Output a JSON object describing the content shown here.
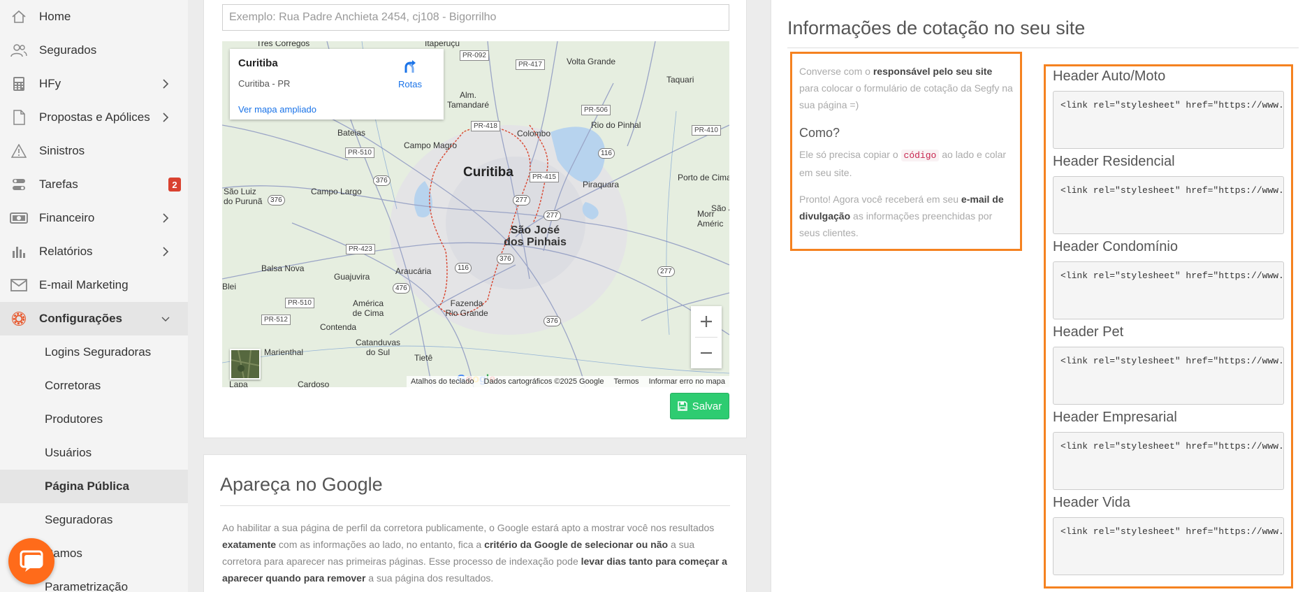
{
  "sidebar": {
    "items": [
      {
        "label": "Home",
        "icon": "home-icon"
      },
      {
        "label": "Segurados",
        "icon": "users-icon"
      },
      {
        "label": "HFy",
        "icon": "calculator-icon",
        "chevron": true
      },
      {
        "label": "Propostas e Apólices",
        "icon": "document-icon",
        "chevron": true
      },
      {
        "label": "Sinistros",
        "icon": "warning-icon"
      },
      {
        "label": "Tarefas",
        "icon": "tasks-icon",
        "badge": "2"
      },
      {
        "label": "Financeiro",
        "icon": "money-icon",
        "chevron": true
      },
      {
        "label": "Relatórios",
        "icon": "bar-chart-icon",
        "chevron": true
      },
      {
        "label": "E-mail Marketing",
        "icon": "envelope-icon"
      },
      {
        "label": "Configurações",
        "icon": "gear-icon",
        "expanded": true
      }
    ],
    "subitems": [
      "Logins Seguradoras",
      "Corretoras",
      "Produtores",
      "Usuários",
      "Página Pública",
      "Seguradoras",
      "Ramos",
      "Parametrização"
    ],
    "active_subitem": "Página Pública"
  },
  "address": {
    "placeholder": "Exemplo: Rua Padre Anchieta 2454, cj108 - Bigorrilho"
  },
  "map": {
    "place_name": "Curitiba",
    "place_region": "Curitiba - PR",
    "routes_label": "Rotas",
    "larger_map_link": "Ver mapa ampliado",
    "labels": {
      "curitiba": "Curitiba",
      "sao_jose": "São José dos Pinhais",
      "tres_corregos": "Três Córregos",
      "itaperucu": "Itaperuçu",
      "volta_grande": "Volta Grande",
      "taquari": "Taquari",
      "almirante": "Alm. Tamandaré",
      "rio_do_pinhal": "Rio do Pinhal",
      "colombo": "Colombo",
      "bateias": "Bateias",
      "campo_magro": "Campo Magro",
      "sao_luiz": "São Luiz do Purunã",
      "campo_largo": "Campo Largo",
      "piraquara": "Piraquara",
      "porto_de_cima": "Porto de Cima",
      "sao_joao": "São J",
      "morretes": "Morr Améric",
      "balsa_nova": "Balsa Nova",
      "guajuvira": "Guajuvira",
      "araucaria": "Araucária",
      "bleri": "Blei",
      "america_de_cima": "América de Cima",
      "fazenda": "Fazenda Rio Grande",
      "contenda": "Contenda",
      "catanduvas": "Catanduvas do Sul",
      "marienthal": "Marienthal",
      "tiete": "Tietê",
      "lapa": "Lapa",
      "cardoso": "Cardoso"
    },
    "roads": {
      "pr092": "PR-092",
      "pr417": "PR-417",
      "pr418": "PR-418",
      "pr506": "PR-506",
      "pr410": "PR-410",
      "pr510a": "PR-510",
      "pr415": "PR-415",
      "pr423": "PR-423",
      "pr510b": "PR-510",
      "pr512": "PR-512",
      "n376a": "376",
      "n376b": "376",
      "n376c": "376",
      "n376d": "376",
      "n277a": "277",
      "n277b": "277",
      "n277c": "277",
      "n116a": "116",
      "n116b": "116",
      "n476": "476"
    },
    "google": "Google",
    "footer": [
      "Atalhos do teclado",
      "Dados cartográficos ©2025 Google",
      "Termos",
      "Informar erro no mapa"
    ]
  },
  "save_label": "Salvar",
  "google_card": {
    "title": "Apareça no Google",
    "text_parts": [
      "Ao habilitar a sua página de perfil da corretora publicamente, o Google estará apto a mostrar você nos resultados ",
      "exatamente",
      " com as informações ao lado, no entanto, fica a ",
      "critério da Google de selecionar ou não",
      " a sua corretora para aparecer nas primeiras páginas. Esse processo de indexação pode ",
      "levar dias tanto para começar a aparecer quando para remover",
      " a sua página dos resultados."
    ]
  },
  "quote": {
    "title": "Informações de cotação no seu site",
    "intro": [
      "Converse com o ",
      "responsável pelo seu site",
      " para colocar o formulário de cotação da Segfy na sua página =)"
    ],
    "how_title": "Como?",
    "how": [
      "Ele só precisa copiar o ",
      "código",
      " ao lado e colar em seu site."
    ],
    "ready": [
      "Pronto! Agora você receberá em seu ",
      "e-mail de divulgação",
      " as informações preenchidas por seus clientes."
    ],
    "headers": [
      {
        "title": "Header Auto/Moto",
        "code": "<link rel=\"stylesheet\" href=\"https://www.segfy.com/Content/css/Segfy/segfy-iframe.css\">"
      },
      {
        "title": "Header Residencial",
        "code": "<link rel=\"stylesheet\" href=\"https://www.segfy.com/Content/css/Segfy/segfy-iframe-residencial.css\">"
      },
      {
        "title": "Header Condomínio",
        "code": "<link rel=\"stylesheet\" href=\"https://www.segfy.com/Content/css/Segfy/segfy-iframe-condominio.css\">"
      },
      {
        "title": "Header Pet",
        "code": "<link rel=\"stylesheet\" href=\"https://www.segfy.com/Content/css/Segfy/segfy-iframe-pet.css\">"
      },
      {
        "title": "Header Empresarial",
        "code": "<link rel=\"stylesheet\" href=\"https://www.segfy.com/Content/css/Segfy/segfy-iframe-empresarial.css\">"
      },
      {
        "title": "Header Vida",
        "code": "<link rel=\"stylesheet\" href=\"https://www.segfy.com/Content/css/Segfy/segfy-iframe-vida.css\">"
      }
    ]
  },
  "colors": {
    "accent": "#f58220",
    "save": "#2ecc71",
    "badge": "#d9412f",
    "chat": "#ff6b1a",
    "active_icon": "#e8562a"
  }
}
